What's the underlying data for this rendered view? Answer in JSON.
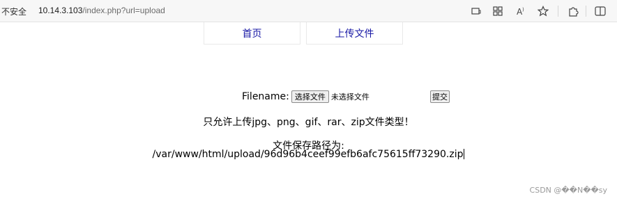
{
  "browser": {
    "security_label": "不安全",
    "url_host": "10.14.3.103",
    "url_path": "/index.php?url=upload",
    "icons": [
      "reader-icon",
      "apps-icon",
      "read-aloud-icon",
      "favorite-star-icon",
      "extensions-icon",
      "split-screen-icon"
    ]
  },
  "nav": {
    "items": [
      {
        "label": "首页"
      },
      {
        "label": "上传文件"
      }
    ],
    "link_color": "#1a1aa6"
  },
  "form": {
    "filename_label": "Filename:",
    "choose_file_button": "选择文件",
    "no_file_text": "未选择文件",
    "submit_button": "提交"
  },
  "messages": {
    "allowed_types": "只允许上传jpg、png、gif、rar、zip文件类型！",
    "save_path_label": "文件保存路径为:",
    "save_path": "/var/www/html/upload/96d96b4ceef99efb6afc75615ff73290.zip"
  },
  "watermark": "CSDN @��N��sy"
}
